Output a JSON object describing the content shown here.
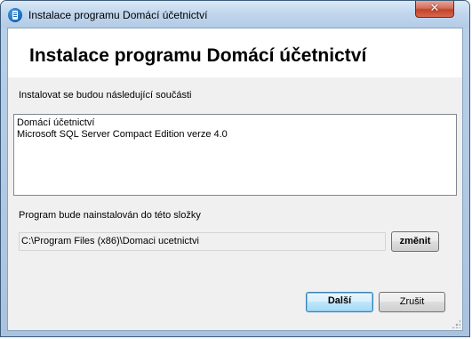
{
  "window": {
    "title": "Instalace programu Domácí účetnictví",
    "close_glyph": "✕",
    "icon": "app-icon"
  },
  "header": {
    "title": "Instalace programu Domácí účetnictví"
  },
  "components": {
    "label": "Instalovat se budou následující součásti",
    "items": [
      "Domácí účetnictví",
      "Microsoft SQL Server Compact Edition verze 4.0"
    ]
  },
  "install_location": {
    "label": "Program bude nainstalován do této složky",
    "path": "C:\\Program Files (x86)\\Domaci ucetnictvi",
    "change_label": "změnit"
  },
  "footer": {
    "next_label": "Další",
    "cancel_label": "Zrušit"
  },
  "colors": {
    "title_bar": "#c2d7ee",
    "client_bg": "#f0f0f0",
    "close_button": "#c2432a",
    "default_button_border": "#3c7fb1"
  }
}
